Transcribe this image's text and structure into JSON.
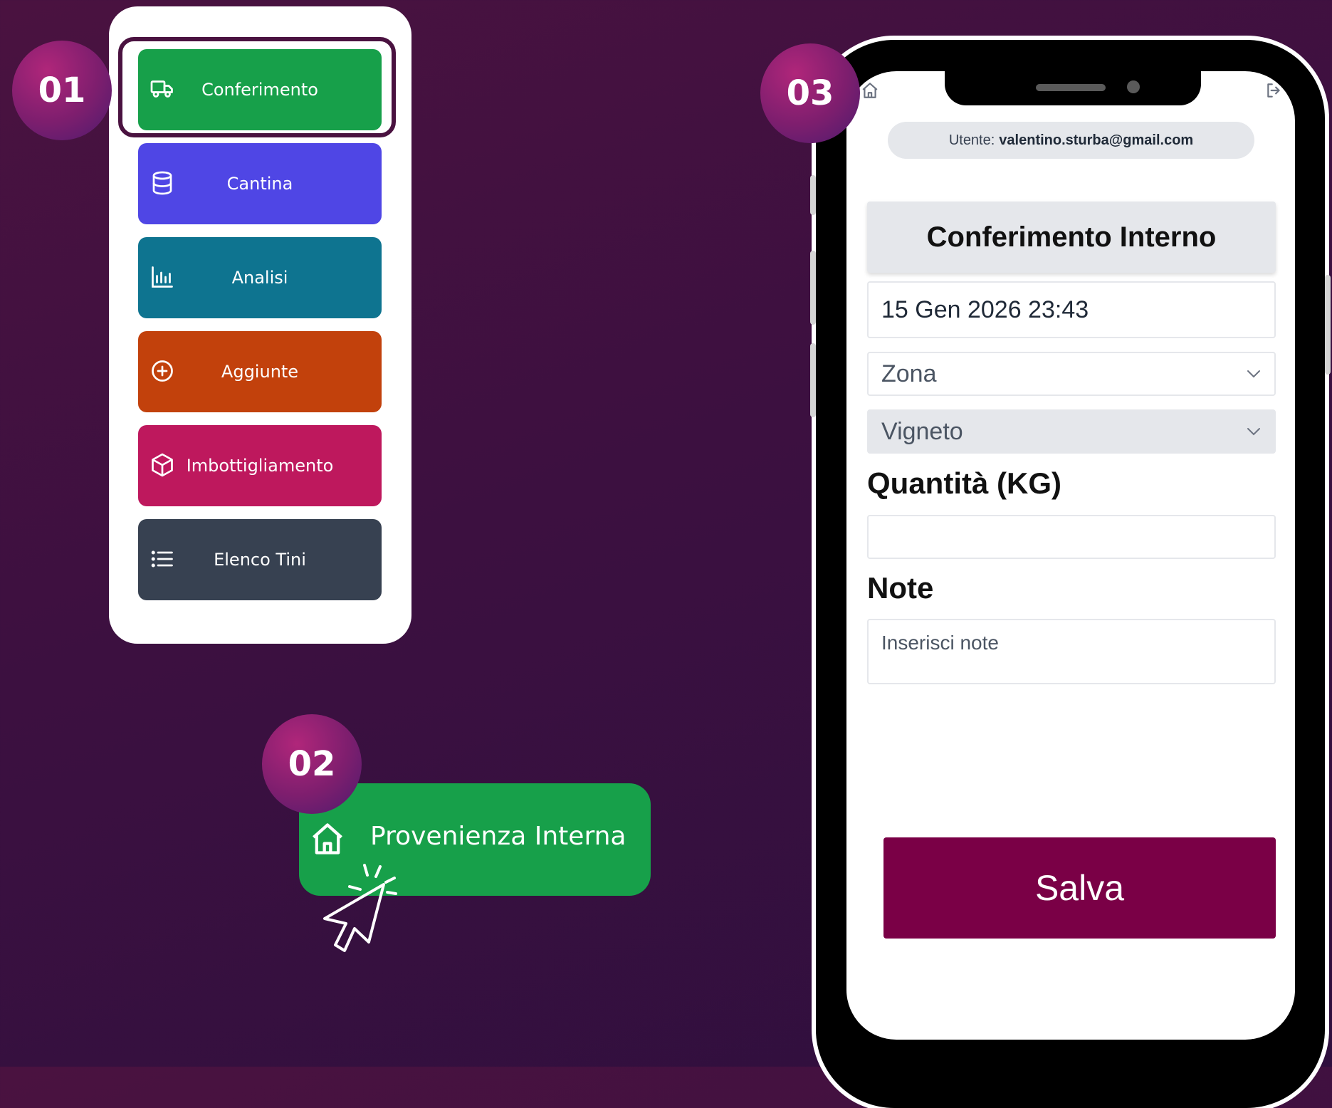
{
  "steps": {
    "step1": "01",
    "step2": "02",
    "step3": "03"
  },
  "menu": {
    "items": [
      {
        "label": "Conferimento",
        "color": "#17a04a",
        "icon": "truck-icon"
      },
      {
        "label": "Cantina",
        "color": "#4f46e5",
        "icon": "database-icon"
      },
      {
        "label": "Analisi",
        "color": "#0e7490",
        "icon": "bar-chart-icon"
      },
      {
        "label": "Aggiunte",
        "color": "#c2410c",
        "icon": "plus-circle-icon"
      },
      {
        "label": "Imbottigliamento",
        "color": "#be185d",
        "icon": "box-icon"
      },
      {
        "label": "Elenco Tini",
        "color": "#374151",
        "icon": "list-icon"
      }
    ]
  },
  "provenance_button": {
    "label": "Provenienza Interna",
    "icon": "home-icon",
    "color": "#17a04a"
  },
  "form": {
    "user_prefix": "Utente:",
    "user_email": "valentino.sturba@gmail.com",
    "title": "Conferimento Interno",
    "datetime_value": "15 Gen 2026 23:43",
    "zona_placeholder": "Zona",
    "vigneto_placeholder": "Vigneto",
    "quantity_label": "Quantità (KG)",
    "quantity_value": "",
    "note_label": "Note",
    "note_placeholder": "Inserisci note",
    "save_label": "Salva",
    "save_color": "#7a0046"
  }
}
